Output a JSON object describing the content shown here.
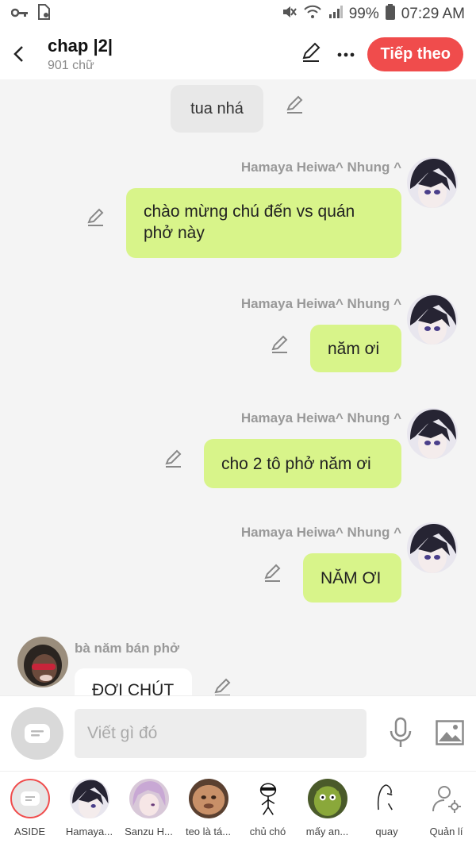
{
  "status": {
    "battery": "99%",
    "time": "07:29 AM"
  },
  "header": {
    "title": "chap |2|",
    "subtitle": "901 chữ",
    "next_label": "Tiếp theo"
  },
  "chat": {
    "system_message": "tua nhá",
    "messages": [
      {
        "sender": "Hamaya Heiwa^ Nhung ^",
        "lines": [
          "chào mừng chú đến vs quán",
          "phở này"
        ]
      },
      {
        "sender": "Hamaya Heiwa^ Nhung ^",
        "lines": [
          "năm ơi"
        ]
      },
      {
        "sender": "Hamaya Heiwa^ Nhung ^",
        "lines": [
          "cho 2 tô phở năm ơi"
        ]
      },
      {
        "sender": "Hamaya Heiwa^ Nhung ^",
        "lines": [
          "NĂM ƠI"
        ]
      }
    ],
    "incoming": {
      "sender": "bà năm bán phở",
      "text": "ĐỢI CHÚT"
    }
  },
  "input": {
    "placeholder": "Viết gì đó"
  },
  "characters": [
    {
      "label": "ASIDE"
    },
    {
      "label": "Hamaya..."
    },
    {
      "label": "Sanzu H..."
    },
    {
      "label": "teo là tá..."
    },
    {
      "label": "chủ chó"
    },
    {
      "label": "mấy an..."
    },
    {
      "label": "quay"
    },
    {
      "label": "Quản lí"
    }
  ],
  "colors": {
    "accent": "#f04c4c",
    "bubble": "#d8f48a",
    "grey": "#999999"
  }
}
